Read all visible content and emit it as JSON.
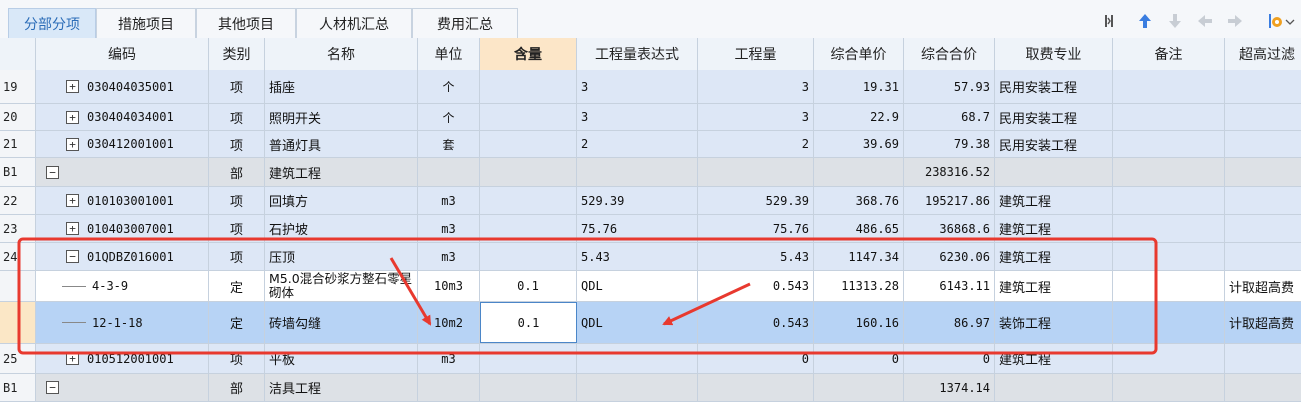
{
  "tabs": [
    {
      "label": "分部分项",
      "active": true
    },
    {
      "label": "措施项目",
      "active": false
    },
    {
      "label": "其他项目",
      "active": false
    },
    {
      "label": "人材机汇总",
      "active": false
    },
    {
      "label": "费用汇总",
      "active": false
    }
  ],
  "toolbar": {
    "icons": [
      "collapse-icon",
      "arrow-up-icon",
      "arrow-down-icon",
      "arrow-left-icon",
      "arrow-right-icon",
      "settings-icon"
    ],
    "accent_color": "#3a7de0"
  },
  "columns": {
    "code": "编码",
    "type": "类别",
    "name": "名称",
    "unit": "单位",
    "content": "含量",
    "expr": "工程量表达式",
    "qty": "工程量",
    "unit_price": "综合单价",
    "total": "综合合价",
    "fee_spec": "取费专业",
    "remark": "备注",
    "overheight": "超高过滤"
  },
  "rows": [
    {
      "rownum": "19",
      "kind": "xiang",
      "expander": "+",
      "code": "030404035001",
      "type": "项",
      "name": "插座",
      "unit": "个",
      "content": "",
      "expr": "3",
      "qty": "3",
      "unit_price": "19.31",
      "total": "57.93",
      "fee_spec": "民用安装工程",
      "remark": "",
      "overheight": ""
    },
    {
      "rownum": "20",
      "kind": "xiang",
      "expander": "+",
      "code": "030404034001",
      "type": "项",
      "name": "照明开关",
      "unit": "个",
      "content": "",
      "expr": "3",
      "qty": "3",
      "unit_price": "22.9",
      "total": "68.7",
      "fee_spec": "民用安装工程",
      "remark": "",
      "overheight": ""
    },
    {
      "rownum": "21",
      "kind": "xiang",
      "expander": "+",
      "code": "030412001001",
      "type": "项",
      "name": "普通灯具",
      "unit": "套",
      "content": "",
      "expr": "2",
      "qty": "2",
      "unit_price": "39.69",
      "total": "79.38",
      "fee_spec": "民用安装工程",
      "remark": "",
      "overheight": ""
    },
    {
      "rownum": "B1",
      "kind": "bu",
      "expander": "−",
      "code": "",
      "type": "部",
      "name": "建筑工程",
      "unit": "",
      "content": "",
      "expr": "",
      "qty": "",
      "unit_price": "",
      "total": "238316.52",
      "fee_spec": "",
      "remark": "",
      "overheight": ""
    },
    {
      "rownum": "22",
      "kind": "xiang",
      "expander": "+",
      "code": "010103001001",
      "type": "项",
      "name": "回填方",
      "unit": "m3",
      "content": "",
      "expr": "529.39",
      "qty": "529.39",
      "unit_price": "368.76",
      "total": "195217.86",
      "fee_spec": "建筑工程",
      "remark": "",
      "overheight": ""
    },
    {
      "rownum": "23",
      "kind": "xiang",
      "expander": "+",
      "code": "010403007001",
      "type": "项",
      "name": "石护坡",
      "unit": "m3",
      "content": "",
      "expr": "75.76",
      "qty": "75.76",
      "unit_price": "486.65",
      "total": "36868.6",
      "fee_spec": "建筑工程",
      "remark": "",
      "overheight": ""
    },
    {
      "rownum": "24",
      "kind": "xiang",
      "expander": "−",
      "code": "01QDBZ016001",
      "type": "项",
      "name": "压顶",
      "unit": "m3",
      "content": "",
      "expr": "5.43",
      "qty": "5.43",
      "unit_price": "1147.34",
      "total": "6230.06",
      "fee_spec": "建筑工程",
      "remark": "",
      "overheight": ""
    },
    {
      "rownum": "",
      "kind": "ding",
      "expander": "",
      "code": "4-3-9",
      "type": "定",
      "name": "M5.0混合砂浆方整石零星砌体",
      "unit": "10m3",
      "content": "0.1",
      "expr": "QDL",
      "qty": "0.543",
      "unit_price": "11313.28",
      "total": "6143.11",
      "fee_spec": "建筑工程",
      "remark": "",
      "overheight": "计取超高费"
    },
    {
      "rownum": "",
      "kind": "sel",
      "expander": "",
      "code": "12-1-18",
      "type": "定",
      "name": "砖墙勾缝",
      "unit": "10m2",
      "content": "0.1",
      "expr": "QDL",
      "qty": "0.543",
      "unit_price": "160.16",
      "total": "86.97",
      "fee_spec": "装饰工程",
      "remark": "",
      "overheight": "计取超高费"
    },
    {
      "rownum": "25",
      "kind": "xiang",
      "expander": "+",
      "code": "010512001001",
      "type": "项",
      "name": "平板",
      "unit": "m3",
      "content": "",
      "expr": "",
      "qty": "0",
      "unit_price": "0",
      "total": "0",
      "fee_spec": "建筑工程",
      "remark": "",
      "overheight": ""
    },
    {
      "rownum": "B1",
      "kind": "bu",
      "expander": "−",
      "code": "",
      "type": "部",
      "name": "洁具工程",
      "unit": "",
      "content": "",
      "expr": "",
      "qty": "",
      "unit_price": "",
      "total": "1374.14",
      "fee_spec": "",
      "remark": "",
      "overheight": ""
    }
  ],
  "annotation": {
    "highlight_color": "#e8392f"
  }
}
